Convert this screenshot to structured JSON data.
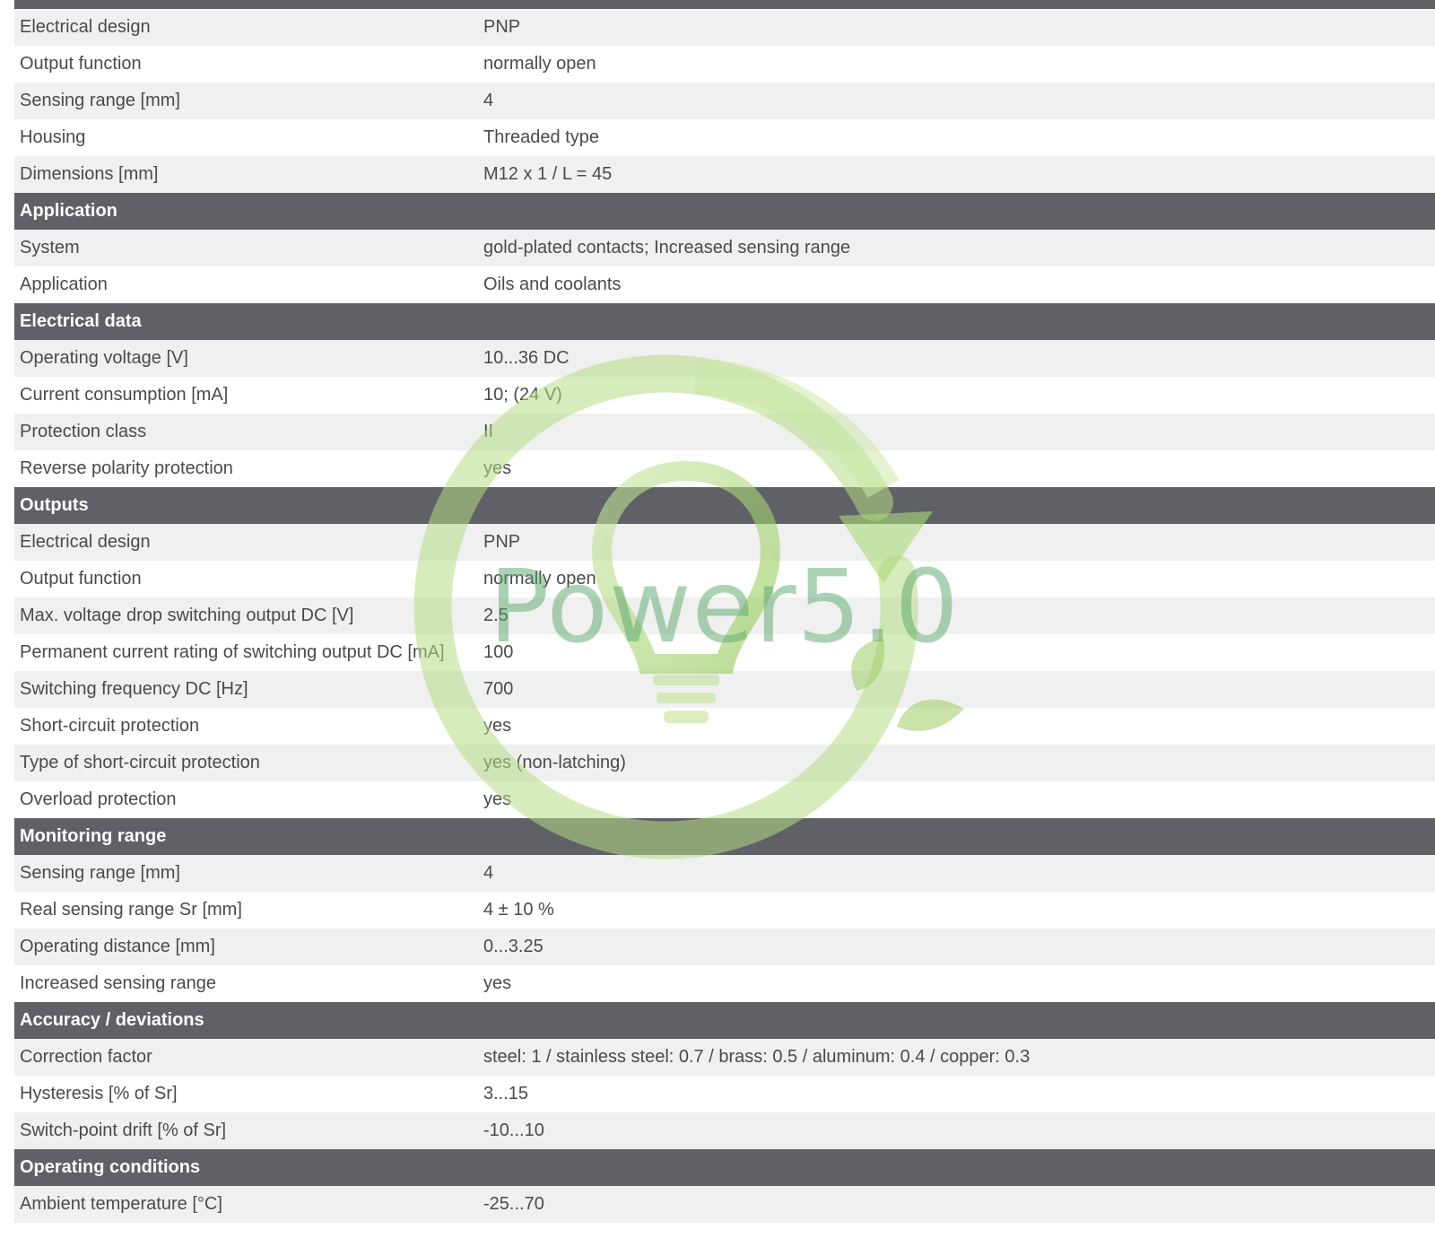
{
  "colors": {
    "section_bg": "#606166",
    "row_alt_bg": "#f0f0f0",
    "text": "#4a4a4a",
    "watermark_green": "#9ccc50"
  },
  "watermark": {
    "text": "Power5.0",
    "icon": "lightbulb-recycle-icon"
  },
  "rows": [
    {
      "type": "row",
      "label": "Electrical design",
      "value": "PNP"
    },
    {
      "type": "row",
      "label": "Output function",
      "value": "normally open"
    },
    {
      "type": "row",
      "label": "Sensing range [mm]",
      "value": "4"
    },
    {
      "type": "row",
      "label": "Housing",
      "value": "Threaded type"
    },
    {
      "type": "row",
      "label": "Dimensions [mm]",
      "value": "M12 x 1 / L = 45"
    },
    {
      "type": "section",
      "label": "Application"
    },
    {
      "type": "row",
      "label": "System",
      "value": "gold-plated contacts; Increased sensing range"
    },
    {
      "type": "row",
      "label": "Application",
      "value": "Oils and coolants"
    },
    {
      "type": "section",
      "label": "Electrical data"
    },
    {
      "type": "row",
      "label": "Operating voltage [V]",
      "value": "10...36 DC"
    },
    {
      "type": "row",
      "label": "Current consumption [mA]",
      "value": "10; (24 V)"
    },
    {
      "type": "row",
      "label": "Protection class",
      "value": "II"
    },
    {
      "type": "row",
      "label": "Reverse polarity protection",
      "value": "yes"
    },
    {
      "type": "section",
      "label": "Outputs"
    },
    {
      "type": "row",
      "label": "Electrical design",
      "value": "PNP"
    },
    {
      "type": "row",
      "label": "Output function",
      "value": "normally open"
    },
    {
      "type": "row",
      "label": "Max. voltage drop switching output DC [V]",
      "value": "2.5"
    },
    {
      "type": "row",
      "label": "Permanent current rating of switching output DC [mA]",
      "value": "100"
    },
    {
      "type": "row",
      "label": "Switching frequency DC [Hz]",
      "value": "700"
    },
    {
      "type": "row",
      "label": "Short-circuit protection",
      "value": "yes"
    },
    {
      "type": "row",
      "label": "Type of short-circuit protection",
      "value": "yes (non-latching)"
    },
    {
      "type": "row",
      "label": "Overload protection",
      "value": "yes"
    },
    {
      "type": "section",
      "label": "Monitoring range"
    },
    {
      "type": "row",
      "label": "Sensing range [mm]",
      "value": "4"
    },
    {
      "type": "row",
      "label": "Real sensing range Sr [mm]",
      "value": "4 ± 10 %"
    },
    {
      "type": "row",
      "label": "Operating distance [mm]",
      "value": "0...3.25"
    },
    {
      "type": "row",
      "label": "Increased sensing range",
      "value": "yes"
    },
    {
      "type": "section",
      "label": "Accuracy / deviations"
    },
    {
      "type": "row",
      "label": "Correction factor",
      "value": "steel: 1 / stainless steel: 0.7 / brass: 0.5 / aluminum: 0.4 / copper: 0.3"
    },
    {
      "type": "row",
      "label": "Hysteresis [% of Sr]",
      "value": "3...15"
    },
    {
      "type": "row",
      "label": "Switch-point drift [% of Sr]",
      "value": "-10...10"
    },
    {
      "type": "section",
      "label": "Operating conditions"
    },
    {
      "type": "row",
      "label": "Ambient temperature [°C]",
      "value": "-25...70"
    }
  ]
}
